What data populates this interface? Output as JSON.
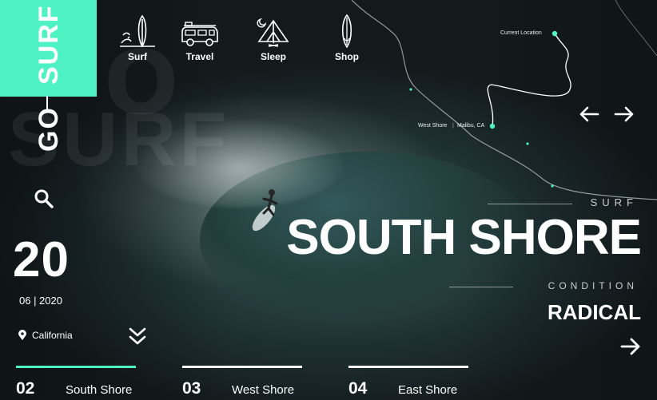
{
  "brand": {
    "word_top": "SURF",
    "word_bottom": "GO"
  },
  "nav": [
    {
      "label": "Surf",
      "icon": "surfboard-wave-icon"
    },
    {
      "label": "Travel",
      "icon": "van-icon"
    },
    {
      "label": "Sleep",
      "icon": "tent-moon-icon"
    },
    {
      "label": "Shop",
      "icon": "surfboard-icon"
    }
  ],
  "map": {
    "current_location": "Current Location",
    "west_shore": "West Shore",
    "malibu": "Malibu, CA"
  },
  "date": {
    "day": "20",
    "month_year": "06 | 2020"
  },
  "location": {
    "label": "California"
  },
  "hero": {
    "category": "SURF",
    "title": "SOUTH SHORE",
    "condition_label": "CONDITION",
    "condition_value": "RADICAL"
  },
  "tabs": [
    {
      "number": "02",
      "name": "South Shore"
    },
    {
      "number": "03",
      "name": "West Shore"
    },
    {
      "number": "04",
      "name": "East Shore"
    }
  ],
  "colors": {
    "accent": "#4ff2c4",
    "text": "#ffffff"
  }
}
